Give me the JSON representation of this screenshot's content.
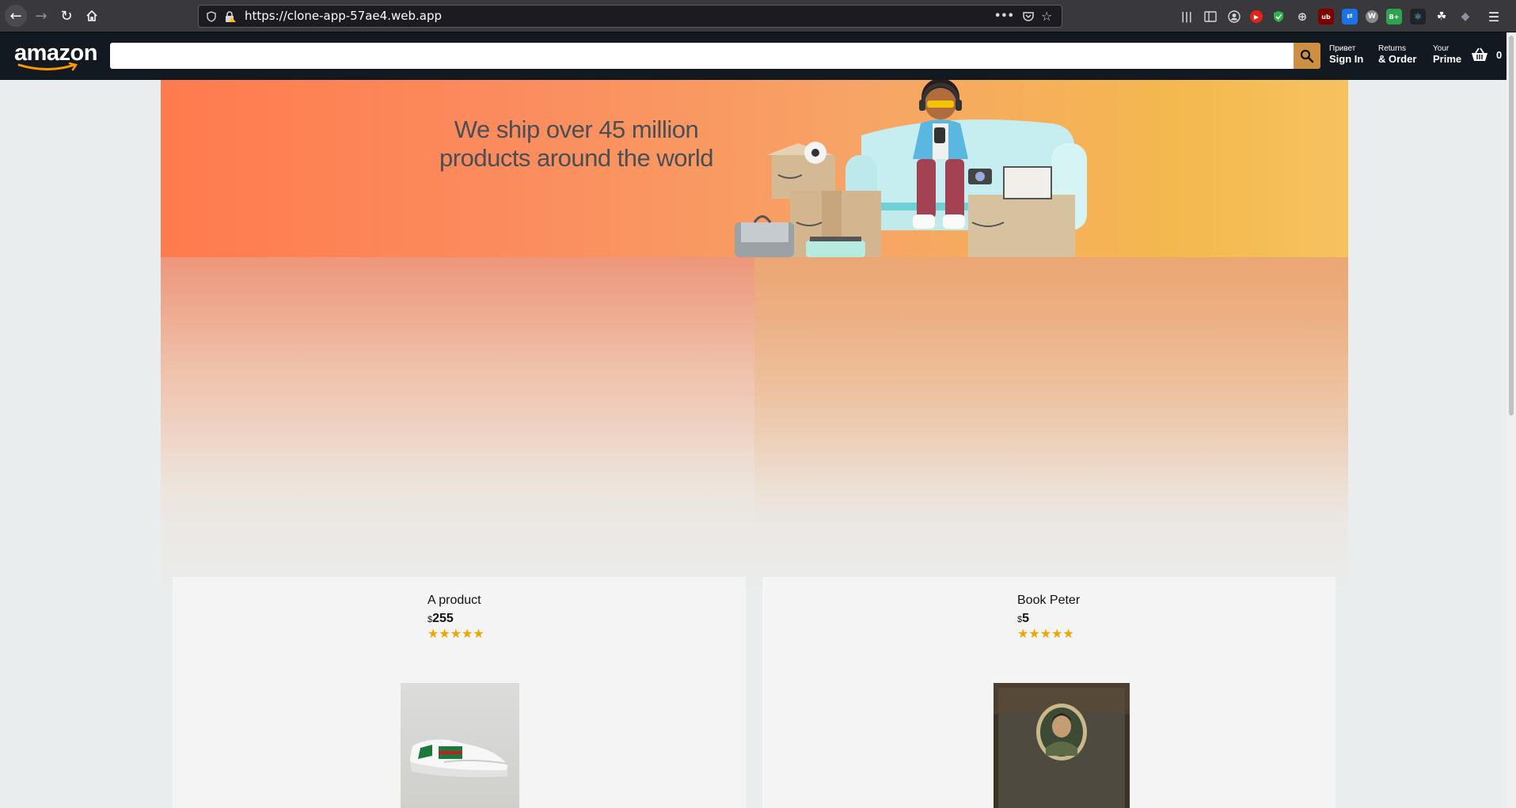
{
  "browser": {
    "url": "https://clone-app-57ae4.web.app",
    "back_icon": "arrow-left-icon",
    "forward_icon": "arrow-right-icon",
    "reload_icon": "reload-icon",
    "home_icon": "home-icon",
    "more_glyph": "•••",
    "extensions": [
      "library-icon",
      "sidebar-icon",
      "account-icon",
      "youtube-icon",
      "shield-icon",
      "globe-icon",
      "ublock-icon",
      "translate-icon",
      "w-icon",
      "bplus-icon",
      "react-icon",
      "gnome-icon",
      "cube-icon"
    ],
    "extension_labels": {
      "ublock": "ub",
      "w": "W",
      "bplus": "B+"
    }
  },
  "header": {
    "logo": "amazon",
    "search": {
      "value": "",
      "placeholder": ""
    },
    "options": [
      {
        "line1": "Привет",
        "line2": "Sign In"
      },
      {
        "line1": "Returns",
        "line2": "& Order"
      },
      {
        "line1": "Your",
        "line2": "Prime"
      }
    ],
    "basket_count": "0"
  },
  "hero": {
    "title_line1": "We ship over 45 million",
    "title_line2": "products around the world",
    "colors": {
      "left": "#ff7b4e",
      "right": "#f6c25e"
    }
  },
  "products": [
    {
      "title": "A product",
      "currency": "$",
      "price": "255",
      "rating": 5,
      "image": "white-sneaker-image"
    },
    {
      "title": "Book Peter",
      "currency": "$",
      "price": "5",
      "rating": 5,
      "image": "book-cover-image"
    }
  ],
  "colors": {
    "header_bg": "#131921",
    "search_btn": "#cd9042",
    "page_bg": "#eaeded",
    "card_bg": "#f4f4f4",
    "star": "#f0a500"
  }
}
